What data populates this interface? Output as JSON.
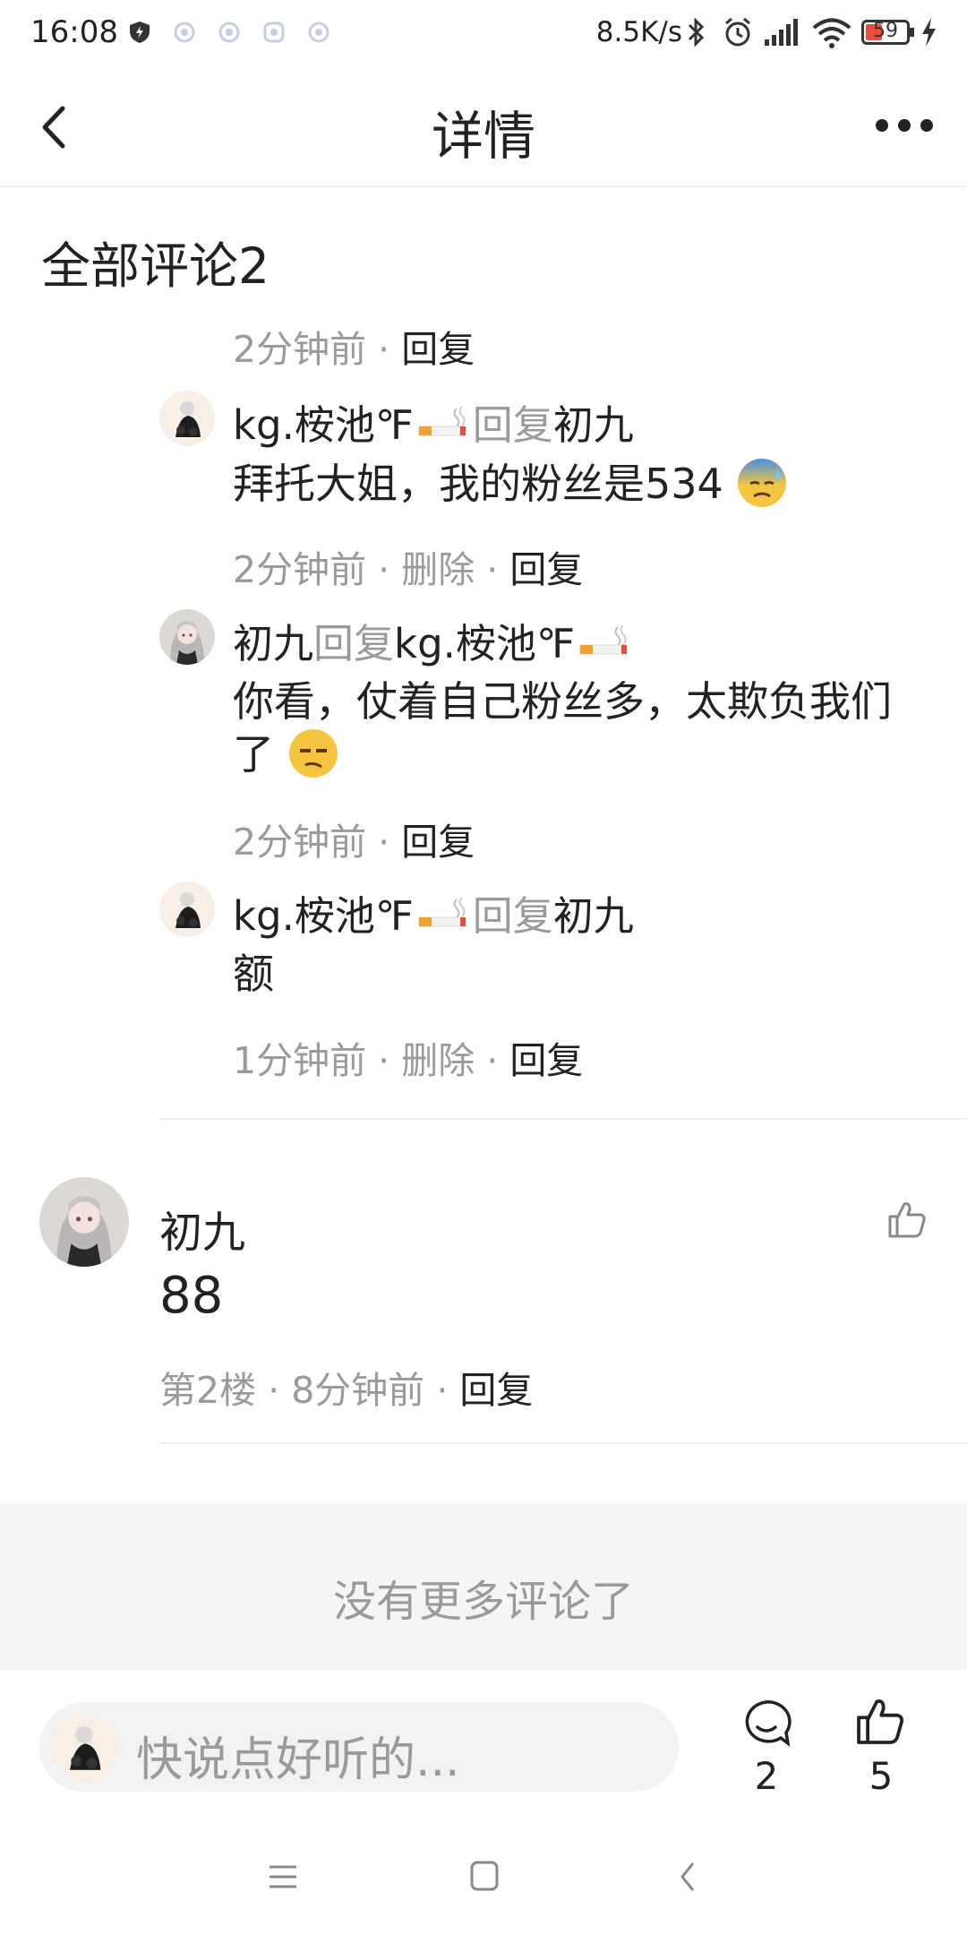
{
  "status_bar": {
    "time": "16:08",
    "net_speed": "8.5K/s",
    "battery": "59",
    "icons": [
      "shield-icon",
      "app-notify-icon",
      "app-notify-icon",
      "app-notify-icon",
      "app-notify-icon",
      "bluetooth-icon",
      "alarm-icon",
      "signal-icon",
      "wifi-icon",
      "battery-icon",
      "charging-icon"
    ]
  },
  "header": {
    "title": "详情",
    "back_icon": "back-chevron-icon",
    "more_icon": "more-icon"
  },
  "comments": {
    "section_title": "全部评论2"
  },
  "replies": [
    {
      "meta_time": "2分钟前",
      "actions": [
        "回复"
      ]
    },
    {
      "author": "kg.桉池℉",
      "reply_word": "回复",
      "target": "初九",
      "text": "拜托大姐，我的粉丝是534",
      "emoji": "cold-sweat-emoji",
      "meta_time": "2分钟前",
      "actions": [
        "删除",
        "回复"
      ]
    },
    {
      "author": "初九",
      "reply_word": "回复",
      "target": "kg.桉池℉",
      "text": "你看，仗着自己粉丝多，太欺负我们了",
      "emoji": "unamused-emoji",
      "meta_time": "2分钟前",
      "actions": [
        "回复"
      ]
    },
    {
      "author": "kg.桉池℉",
      "reply_word": "回复",
      "target": "初九",
      "text": "额",
      "meta_time": "1分钟前",
      "actions": [
        "删除",
        "回复"
      ]
    }
  ],
  "floor_comment": {
    "author": "初九",
    "text": "88",
    "floor": "第2楼",
    "time": "8分钟前",
    "reply": "回复",
    "like_icon": "thumbs-up-icon"
  },
  "end_notice": "没有更多评论了",
  "input_bar": {
    "placeholder": "快说点好听的...",
    "comment_count": "2",
    "like_count": "5"
  },
  "nav_bar": {
    "icons": [
      "menu-icon",
      "home-icon",
      "back-icon"
    ]
  },
  "colors": {
    "text": "#222222",
    "muted": "#9a9a9a",
    "divider": "#eeeeee",
    "end_bg": "#f5f5f5"
  }
}
